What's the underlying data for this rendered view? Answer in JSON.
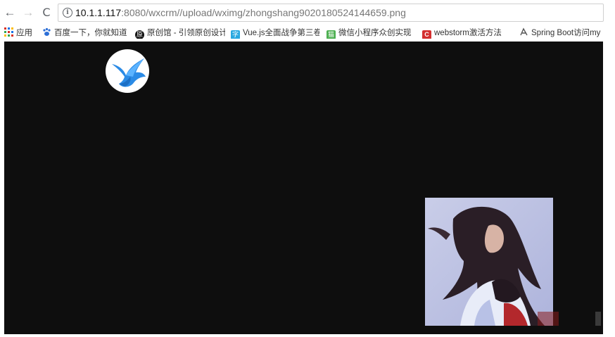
{
  "browser": {
    "url_host": "10.1.1.117",
    "url_rest": ":8080/wxcrm//upload/wximg/zhongshang9020180524144659.png",
    "back_label": "←",
    "forward_label": "→",
    "reload_label": "C",
    "info_label": "i"
  },
  "bookmarks": [
    {
      "label": "应用",
      "icon": "apps-grid-icon",
      "color": "#d93025"
    },
    {
      "label": "百度一下，你就知道",
      "icon": "baidu-paw-icon",
      "color": "#2d6fd6"
    },
    {
      "label": "原创馆 - 引领原创设计",
      "icon": "yuanchuang-icon",
      "color": "#111111"
    },
    {
      "label": "Vue.js全面战争第三卷",
      "icon": "vue-book-icon",
      "color": "#29a8e0"
    },
    {
      "label": "微信小程序众创实现",
      "icon": "wechat-app-icon",
      "color": "#4caf50"
    },
    {
      "label": "webstorm激活方法",
      "icon": "csdn-c-icon",
      "color": "#d32f2f"
    },
    {
      "label": "Spring Boot访问my",
      "icon": "spring-leaf-icon",
      "color": "#555555"
    }
  ]
}
